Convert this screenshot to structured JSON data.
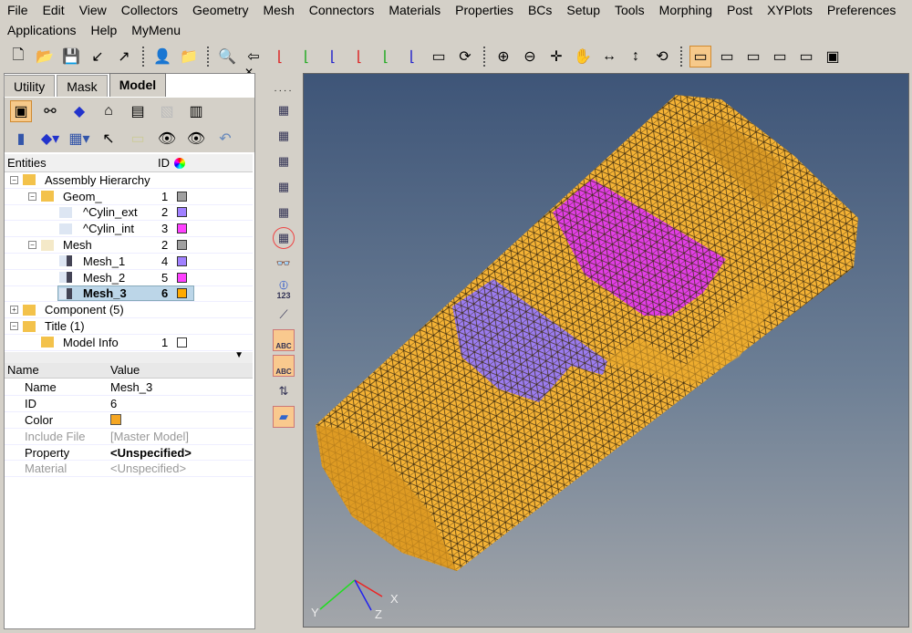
{
  "menu": {
    "row1": [
      "File",
      "Edit",
      "View",
      "Collectors",
      "Geometry",
      "Mesh",
      "Connectors",
      "Materials",
      "Properties",
      "BCs",
      "Setup",
      "Tools",
      "Morphing",
      "Post",
      "XYPlots",
      "Preferences"
    ],
    "row2": [
      "Applications",
      "Help",
      "MyMenu"
    ]
  },
  "toolbar_icons": [
    "new-model-icon",
    "open-model-icon",
    "save-model-icon",
    "import-icon",
    "export-icon",
    "user-profile-icon",
    "files-icon",
    "zoom-icon",
    "previous-view-icon",
    "view-xy-top-icon",
    "view-xy-bottom-icon",
    "view-zx-icon",
    "view-xz-icon",
    "view-zy-icon",
    "view-yz-icon",
    "iso-view-icon",
    "refresh-icon",
    "zoom-in-icon",
    "zoom-out-icon",
    "pan-icon",
    "hand-icon",
    "rotate-horizontal-icon",
    "rotate-vertical-icon",
    "spin-icon",
    "display-mode-1-icon",
    "display-mode-2-icon",
    "display-mode-3-icon",
    "display-mode-4-icon",
    "display-mode-5-icon",
    "screenshot-icon"
  ],
  "tabs": [
    {
      "label": "Utility"
    },
    {
      "label": "Mask"
    },
    {
      "label": "Model",
      "selected": true
    }
  ],
  "entities": {
    "header": "Entities",
    "id_header": "ID",
    "rows": [
      {
        "label": "Assembly Hierarchy",
        "depth": 0,
        "id": "",
        "color": ""
      },
      {
        "label": "Geom_",
        "depth": 1,
        "id": "1",
        "color": "#a0a0a0"
      },
      {
        "label": "^Cylin_ext",
        "depth": 2,
        "id": "2",
        "color": "#a080ff"
      },
      {
        "label": "^Cylin_int",
        "depth": 2,
        "id": "3",
        "color": "#ff40ff"
      },
      {
        "label": "Mesh",
        "depth": 1,
        "id": "2",
        "color": "#a0a0a0"
      },
      {
        "label": "Mesh_1",
        "depth": 2,
        "id": "4",
        "color": "#a080ff"
      },
      {
        "label": "Mesh_2",
        "depth": 2,
        "id": "5",
        "color": "#ff40ff"
      },
      {
        "label": "Mesh_3",
        "depth": 2,
        "id": "6",
        "color": "#ffaa00",
        "selected": true
      },
      {
        "label": "Component (5)",
        "depth": 0,
        "id": "",
        "color": ""
      },
      {
        "label": "Title (1)",
        "depth": 0,
        "id": "",
        "color": ""
      },
      {
        "label": "Model Info",
        "depth": 1,
        "id": "1",
        "color": "#ffffff"
      }
    ]
  },
  "properties": {
    "name_header": "Name",
    "value_header": "Value",
    "rows": [
      {
        "name": "Name",
        "value": "Mesh_3",
        "disabled": false
      },
      {
        "name": "ID",
        "value": "6",
        "disabled": false
      },
      {
        "name": "Color",
        "value": "",
        "color": "#f5a623",
        "disabled": false
      },
      {
        "name": "Include File",
        "value": "[Master Model]",
        "disabled": true
      },
      {
        "name": "Property",
        "value": "<Unspecified>",
        "disabled": false
      },
      {
        "name": "Material",
        "value": "<Unspecified>",
        "disabled": true
      }
    ]
  },
  "vertical_tools": [
    "ec-1",
    "ec-2",
    "ec-3",
    "ec-4",
    "ec-5",
    "ec-6",
    "find-icon",
    "info-123",
    "scale",
    "label-abc",
    "label-abc-2",
    "reorder",
    "element-quality"
  ],
  "vertical_labels": {
    "info": "123",
    "abc": "ABC"
  },
  "triad": {
    "x": "X",
    "y": "Y",
    "z": "Z"
  },
  "colors": {
    "mesh_body": "#f5b335",
    "mesh_ext": "#9b7cf0",
    "mesh_int": "#e23ee6",
    "viewport_top": "#3e5578",
    "viewport_bottom": "#a3a6aa"
  }
}
